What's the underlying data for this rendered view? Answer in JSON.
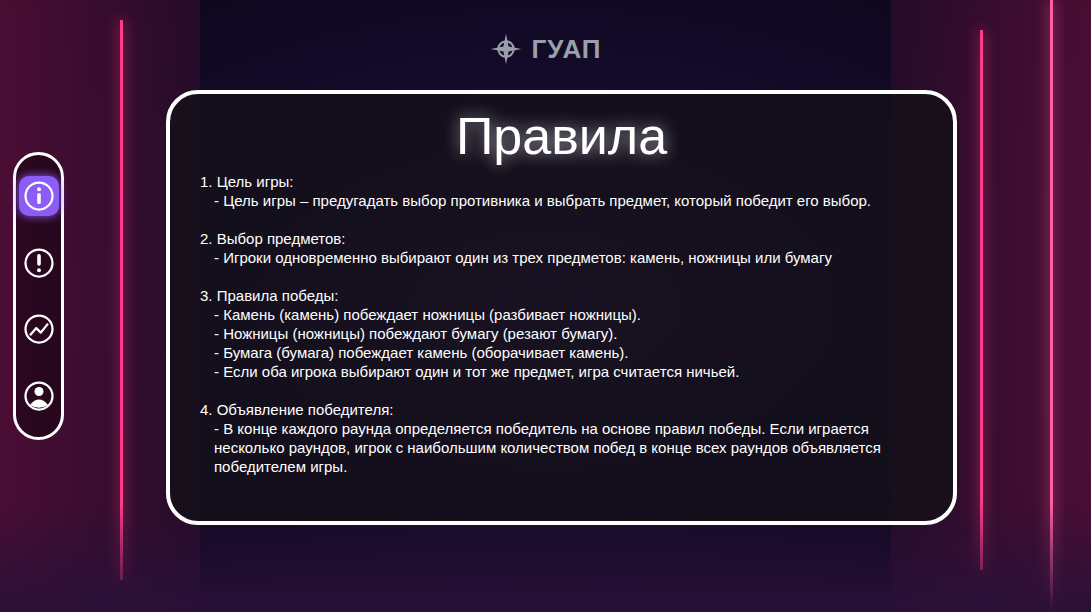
{
  "logo": {
    "text": "ГУАП"
  },
  "sidebar": {
    "items": [
      {
        "selected": true
      },
      {
        "selected": false
      },
      {
        "selected": false
      },
      {
        "selected": false
      }
    ]
  },
  "card": {
    "title": "Правила",
    "sections": [
      {
        "title": "1. Цель игры:",
        "lines": [
          "- Цель игры – предугадать выбор противника и выбрать предмет, который победит его выбор."
        ]
      },
      {
        "title": "2. Выбор предметов:",
        "lines": [
          "- Игроки одновременно выбирают один из трех предметов: камень, ножницы или бумагу"
        ]
      },
      {
        "title": "3. Правила победы:",
        "lines": [
          "- Камень (камень) побеждает ножницы (разбивает ножницы).",
          "- Ножницы (ножницы) побеждают бумагу (резают бумагу).",
          "- Бумага (бумага) побеждает камень (оборачивает камень).",
          "- Если оба игрока выбирают один и тот же предмет, игра считается ничьей."
        ]
      },
      {
        "title": "4. Объявление победителя:",
        "lines": [
          "- В конце каждого раунда определяется победитель на основе правил победы. Если играется несколько раундов, игрок с наибольшим количеством побед в конце всех раундов объявляется победителем игры."
        ]
      }
    ]
  }
}
